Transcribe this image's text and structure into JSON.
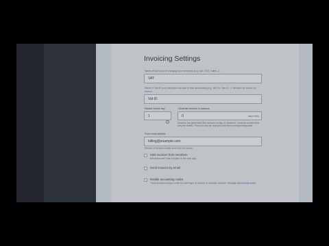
{
  "page": {
    "title": "Invoicing Settings"
  },
  "tax_name": {
    "help": "Name of taxes you're charging your members (e.g. VAT, GST, Sales...).",
    "value": "VAT"
  },
  "tax_id": {
    "help": "Name of Tax ID your members can add to their accounting (e.g. VAT ID, Tax ID,...). Will also be shown on invoice.",
    "value": "Vat ID"
  },
  "default_invoice_day": {
    "label": "Default invoice day",
    "value": "1"
  },
  "generate_in_advance": {
    "label": "Generate invoices in advance",
    "value": "0",
    "suffix": "days early",
    "help": "Invoices are generated this amount of days in advance. Invoices created that way are drafts. They will only be charged until their corresponding date."
  },
  "from_email": {
    "label": "From email address",
    "value": "billing@example.com",
    "help": "Sender of invoice emails sent from the space."
  },
  "options": [
    {
      "label": "Hide invoices from members",
      "help": "Members can't see invoices in the web app.",
      "link": ""
    },
    {
      "label": "Send invoices by email",
      "help": "",
      "link": ""
    },
    {
      "label": "Enable accounting codes",
      "help": "Track invoices using a code for each type of invoice or member account. Manage",
      "link": "accounting codes"
    }
  ]
}
